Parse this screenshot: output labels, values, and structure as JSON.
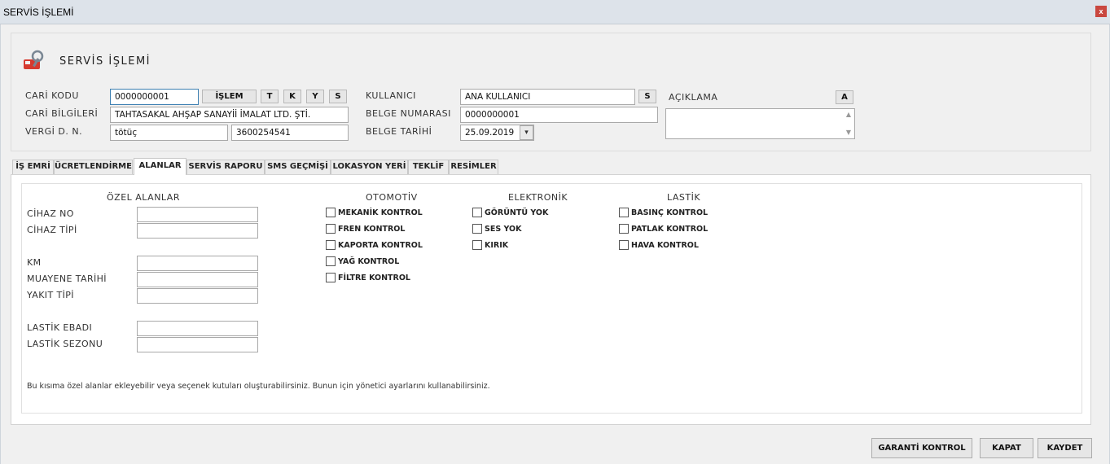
{
  "window": {
    "title": "SERVİS İŞLEMİ",
    "close_label": "x"
  },
  "header": {
    "title": "SERVİS İŞLEMİ",
    "cari_kodu": {
      "label": "CARİ KODU",
      "value": "0000000001"
    },
    "islem_button": "İŞLEM",
    "small_buttons": [
      "T",
      "K",
      "Y",
      "S"
    ],
    "cari_bilgileri": {
      "label": "CARİ BİLGİLERİ",
      "value": "TAHTASAKAL AHŞAP SANAYİİ İMALAT LTD. ŞTİ."
    },
    "vergi": {
      "label": "VERGİ D. N.",
      "daire": "tötüç",
      "numara": "3600254541"
    },
    "kullanici": {
      "label": "KULLANICI",
      "value": "ANA KULLANICI",
      "button": "S"
    },
    "belge_numarasi": {
      "label": "BELGE NUMARASI",
      "value": "0000000001"
    },
    "belge_tarihi": {
      "label": "BELGE TARİHİ",
      "value": "25.09.2019"
    },
    "aciklama": {
      "label": "AÇIKLAMA",
      "button": "A",
      "value": ""
    }
  },
  "tabs": [
    {
      "label": "İŞ EMRİ",
      "active": false
    },
    {
      "label": "ÜCRETLENDİRME",
      "active": false
    },
    {
      "label": "ALANLAR",
      "active": true
    },
    {
      "label": "SERVİS RAPORU",
      "active": false
    },
    {
      "label": "SMS GEÇMİŞİ",
      "active": false
    },
    {
      "label": "LOKASYON YERİ",
      "active": false
    },
    {
      "label": "TEKLİF",
      "active": false
    },
    {
      "label": "RESİMLER",
      "active": false
    }
  ],
  "ozel_alanlar": {
    "title": "ÖZEL ALANLAR",
    "fields": [
      "CİHAZ NO",
      "CİHAZ TİPİ",
      "KM",
      "MUAYENE TARİHİ",
      "YAKIT TİPİ",
      "LASTİK EBADI",
      "LASTİK SEZONU"
    ]
  },
  "otomotiv": {
    "title": "OTOMOTİV",
    "items": [
      "MEKANİK KONTROL",
      "FREN KONTROL",
      "KAPORTA KONTROL",
      "YAĞ KONTROL",
      "FİLTRE KONTROL"
    ]
  },
  "elektronik": {
    "title": "ELEKTRONİK",
    "items": [
      "GÖRÜNTÜ YOK",
      "SES YOK",
      "KIRIK"
    ]
  },
  "lastik": {
    "title": "LASTİK",
    "items": [
      "BASINÇ KONTROL",
      "PATLAK KONTROL",
      "HAVA KONTROL"
    ]
  },
  "note": "Bu kısıma özel alanlar ekleyebilir veya seçenek kutuları oluşturabilirsiniz. Bunun için yönetici ayarlarını kullanabilirsiniz.",
  "footer": {
    "garanti": "GARANTİ KONTROL",
    "kapat": "KAPAT",
    "kaydet": "KAYDET"
  }
}
